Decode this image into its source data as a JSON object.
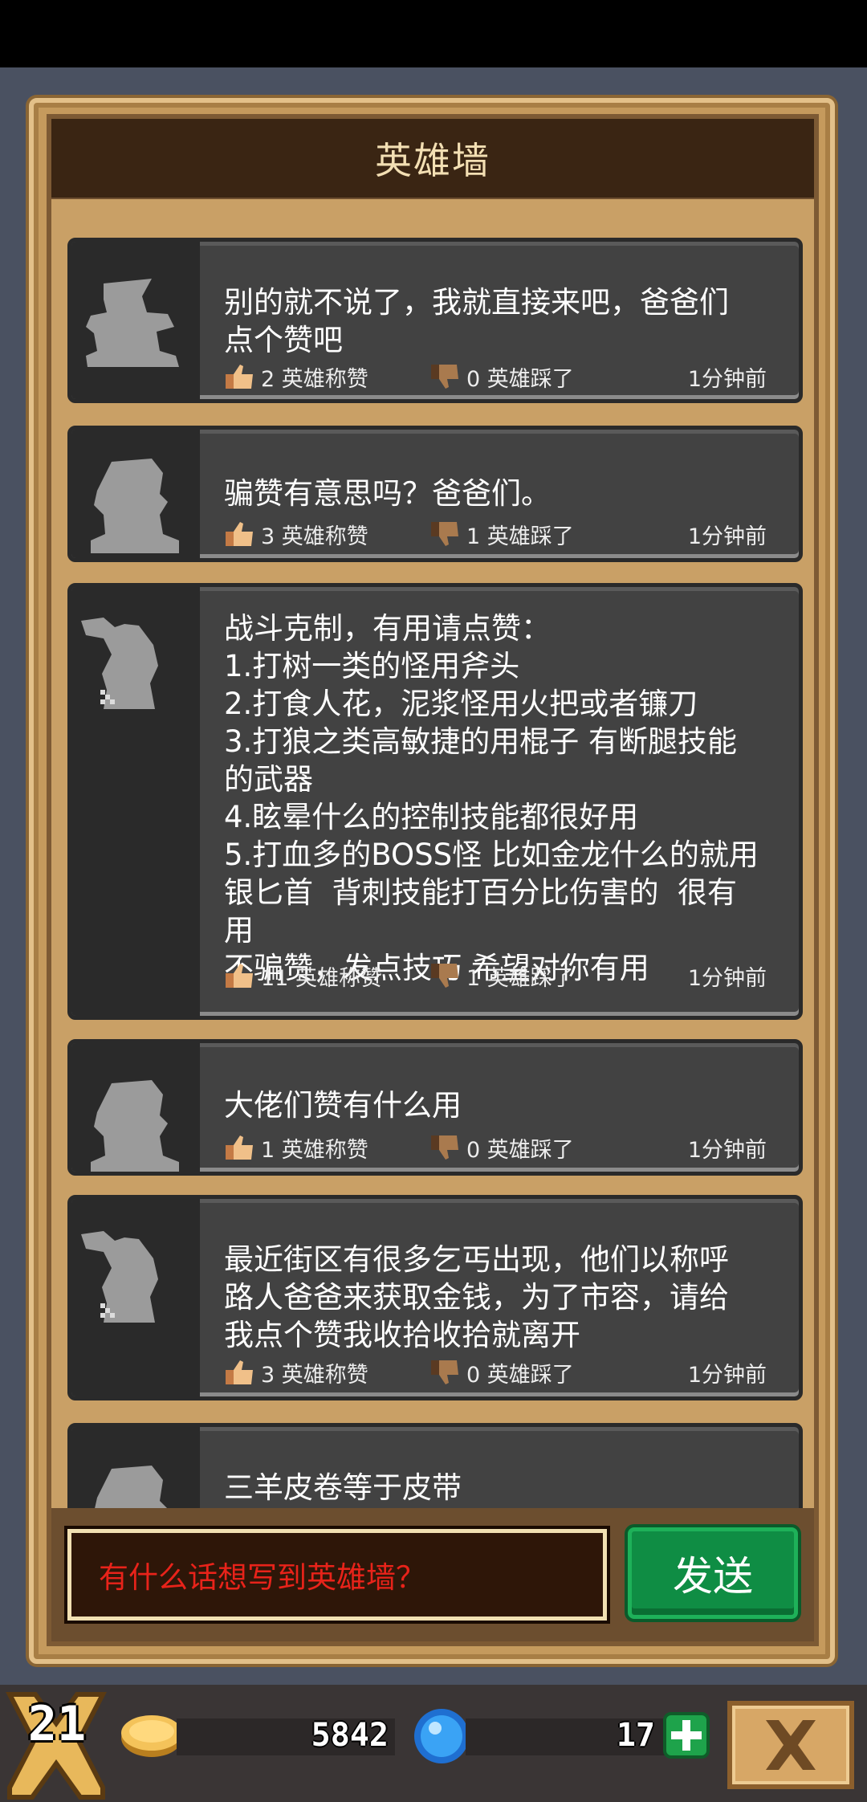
{
  "header": {
    "title": "英雄墙"
  },
  "posts": [
    {
      "message": "别的就不说了，我就直接来吧，爸爸们\n点个赞吧",
      "likes": "2 英雄称赞",
      "dislikes": "0 英雄踩了",
      "time": "1分钟前",
      "avatar": "wizard-silhouette-icon"
    },
    {
      "message": "骗赞有意思吗？爸爸们。",
      "likes": "3 英雄称赞",
      "dislikes": "1 英雄踩了",
      "time": "1分钟前",
      "avatar": "hooded-silhouette-icon"
    },
    {
      "message": "战斗克制，有用请点赞：\n1.打树一类的怪用斧头\n2.打食人花，泥浆怪用火把或者镰刀\n3.打狼之类高敏捷的用棍子 有断腿技能\n的武器\n4.眩晕什么的控制技能都很好用\n5.打血多的BOSS怪 比如金龙什么的就用\n银匕首  背刺技能打百分比伤害的  很有\n用\n不骗赞，发点技巧 希望对你有用",
      "likes": "11 英雄称赞",
      "dislikes": "1 英雄踩了",
      "time": "1分钟前",
      "avatar": "knight-silhouette-icon"
    },
    {
      "message": "大佬们赞有什么用",
      "likes": "1 英雄称赞",
      "dislikes": "0 英雄踩了",
      "time": "1分钟前",
      "avatar": "hooded-silhouette-icon"
    },
    {
      "message": "最近街区有很多乞丐出现，他们以称呼\n路人爸爸来获取金钱，为了市容，请给\n我点个赞我收拾收拾就离开",
      "likes": "3 英雄称赞",
      "dislikes": "0 英雄踩了",
      "time": "1分钟前",
      "avatar": "knight-silhouette-icon"
    },
    {
      "message": "三羊皮卷等于皮带",
      "avatar": "hooded-silhouette-icon"
    }
  ],
  "composer": {
    "placeholder": "有什么话想写到英雄墙？",
    "send_label": "发送"
  },
  "footer": {
    "level": "21",
    "coins": "5842",
    "gems": "17"
  },
  "colors": {
    "panel_border": "#c59a5d",
    "title_bar": "#3a2513",
    "card_bg": "#424242",
    "placeholder_red": "#e8231a",
    "send_green": "#0f8d44"
  }
}
